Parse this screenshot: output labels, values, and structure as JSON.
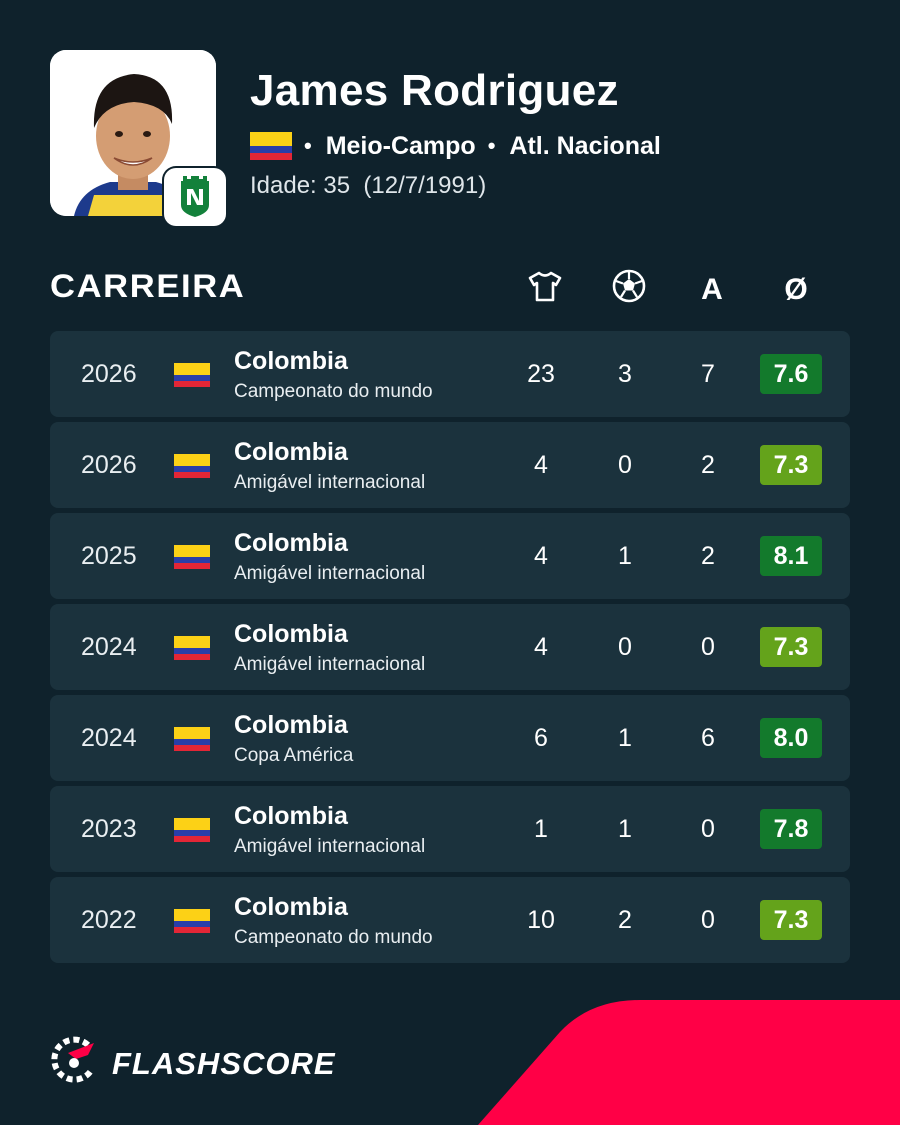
{
  "player": {
    "name": "James Rodriguez",
    "position": "Meio-Campo",
    "club": "Atl. Nacional",
    "age": "Idade: 35  (12/7/1991)",
    "nationality_flag": "colombia-flag-icon",
    "photo": "player-photo",
    "club_badge": "atletico-nacional-crest-icon"
  },
  "career": {
    "title": "CARREIRA",
    "headers": [
      {
        "icon": "shirt-icon",
        "text": ""
      },
      {
        "icon": "ball-icon",
        "text": ""
      },
      {
        "icon": "",
        "text": "A"
      },
      {
        "icon": "",
        "text": "Ø"
      }
    ],
    "rows": [
      {
        "year": "2026",
        "team": "Colombia",
        "competition": "Campeonato do mundo",
        "apps": "23",
        "goals": "3",
        "assists": "7",
        "rating": "7.6"
      },
      {
        "year": "2026",
        "team": "Colombia",
        "competition": "Amigável internacional",
        "apps": "4",
        "goals": "0",
        "assists": "2",
        "rating": "7.3"
      },
      {
        "year": "2025",
        "team": "Colombia",
        "competition": "Amigável internacional",
        "apps": "4",
        "goals": "1",
        "assists": "2",
        "rating": "8.1"
      },
      {
        "year": "2024",
        "team": "Colombia",
        "competition": "Amigável internacional",
        "apps": "4",
        "goals": "0",
        "assists": "0",
        "rating": "7.3"
      },
      {
        "year": "2024",
        "team": "Colombia",
        "competition": "Copa América",
        "apps": "6",
        "goals": "1",
        "assists": "6",
        "rating": "8.0"
      },
      {
        "year": "2023",
        "team": "Colombia",
        "competition": "Amigável internacional",
        "apps": "1",
        "goals": "1",
        "assists": "0",
        "rating": "7.8"
      },
      {
        "year": "2022",
        "team": "Colombia",
        "competition": "Campeonato do mundo",
        "apps": "10",
        "goals": "2",
        "assists": "0",
        "rating": "7.3"
      }
    ]
  },
  "brand": {
    "name": "FLASHSCORE",
    "logo": "flashscore-logo-icon"
  },
  "colors": {
    "background": "#0f222c",
    "row": "#1b323d",
    "rating_high": "#137a2c",
    "rating_mid": "#64a31b",
    "accent": "#ff0046",
    "flag_yellow": "#fcd116",
    "flag_blue": "#2a3ea8",
    "flag_red": "#e32636"
  }
}
